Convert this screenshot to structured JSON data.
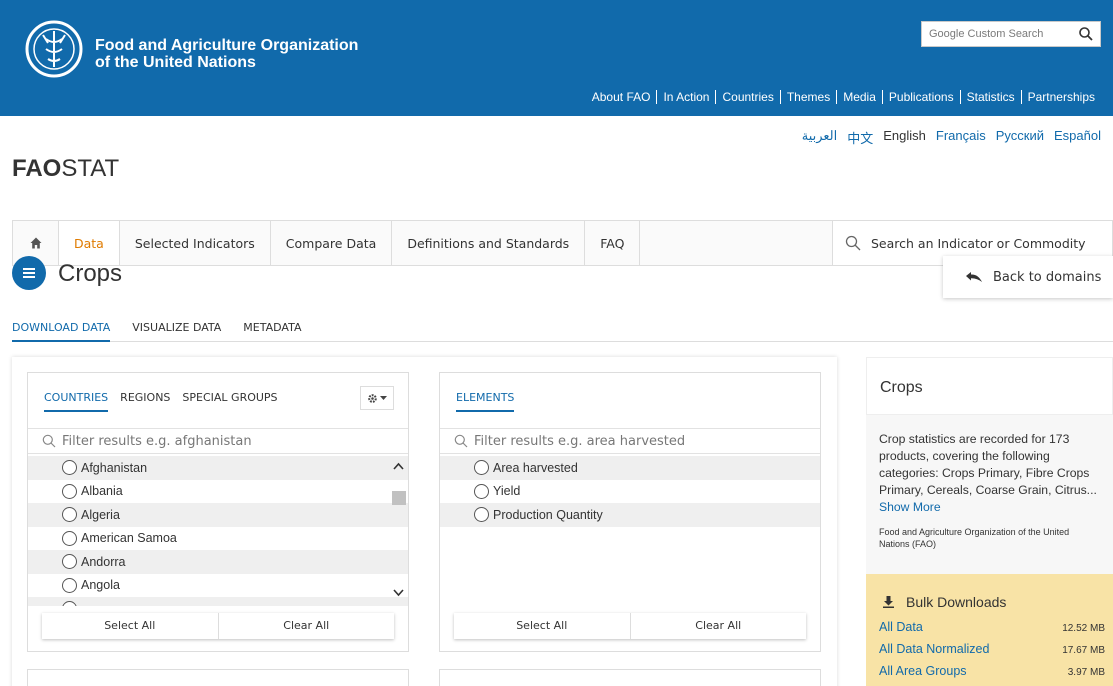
{
  "header": {
    "org_name_line1": "Food and Agriculture Organization",
    "org_name_line2": "of the United Nations",
    "search_placeholder": "Google Custom Search",
    "nav": [
      "About FAO",
      "In Action",
      "Countries",
      "Themes",
      "Media",
      "Publications",
      "Statistics",
      "Partnerships"
    ]
  },
  "languages": [
    "العربية",
    "中文",
    "English",
    "Français",
    "Русский",
    "Español"
  ],
  "languages_active": "English",
  "site_title_bold": "FAO",
  "site_title_rest": "STAT",
  "main_nav": {
    "home_icon": "home-icon",
    "items": [
      "Data",
      "Selected Indicators",
      "Compare Data",
      "Definitions and Standards",
      "FAQ"
    ],
    "active": "Data",
    "search_label": "Search an Indicator or Commodity"
  },
  "page": {
    "title": "Crops",
    "back_label": "Back to domains",
    "tabs": [
      "DOWNLOAD DATA",
      "VISUALIZE DATA",
      "METADATA"
    ],
    "active_tab": "DOWNLOAD DATA"
  },
  "countries_panel": {
    "tabs": [
      "COUNTRIES",
      "REGIONS",
      "SPECIAL GROUPS"
    ],
    "active_tab": "COUNTRIES",
    "filter_placeholder": "Filter results  e.g. afghanistan",
    "options": [
      "Afghanistan",
      "Albania",
      "Algeria",
      "American Samoa",
      "Andorra",
      "Angola"
    ],
    "select_all": "Select All",
    "clear_all": "Clear All"
  },
  "elements_panel": {
    "tabs": [
      "ELEMENTS"
    ],
    "filter_placeholder": "Filter results  e.g. area harvested",
    "options": [
      "Area harvested",
      "Yield",
      "Production Quantity"
    ],
    "select_all": "Select All",
    "clear_all": "Clear All"
  },
  "sidebar": {
    "title": "Crops",
    "description": "Crop statistics are recorded for 173 products, covering the following categories: Crops Primary, Fibre Crops Primary, Cereals, Coarse Grain, Citrus...",
    "show_more": "Show More",
    "source": "Food and Agriculture Organization of the United Nations (FAO)",
    "bulk_title": "Bulk Downloads",
    "bulk_items": [
      {
        "label": "All Data",
        "size": "12.52 MB"
      },
      {
        "label": "All Data Normalized",
        "size": "17.67 MB"
      },
      {
        "label": "All Area Groups",
        "size": "3.97 MB"
      }
    ]
  },
  "colors": {
    "brand_blue": "#116aab",
    "active_orange": "#e07b00",
    "bulk_background": "#f8e3a6"
  }
}
